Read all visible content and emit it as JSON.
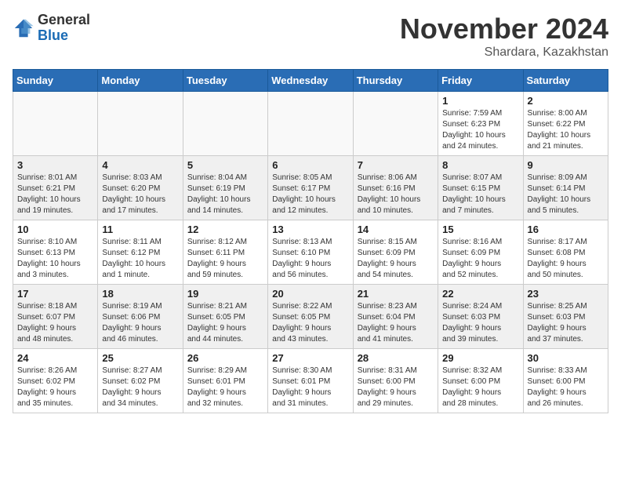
{
  "logo": {
    "general": "General",
    "blue": "Blue"
  },
  "header": {
    "month": "November 2024",
    "location": "Shardara, Kazakhstan"
  },
  "weekdays": [
    "Sunday",
    "Monday",
    "Tuesday",
    "Wednesday",
    "Thursday",
    "Friday",
    "Saturday"
  ],
  "weeks": [
    [
      {
        "day": "",
        "info": ""
      },
      {
        "day": "",
        "info": ""
      },
      {
        "day": "",
        "info": ""
      },
      {
        "day": "",
        "info": ""
      },
      {
        "day": "",
        "info": ""
      },
      {
        "day": "1",
        "info": "Sunrise: 7:59 AM\nSunset: 6:23 PM\nDaylight: 10 hours\nand 24 minutes."
      },
      {
        "day": "2",
        "info": "Sunrise: 8:00 AM\nSunset: 6:22 PM\nDaylight: 10 hours\nand 21 minutes."
      }
    ],
    [
      {
        "day": "3",
        "info": "Sunrise: 8:01 AM\nSunset: 6:21 PM\nDaylight: 10 hours\nand 19 minutes."
      },
      {
        "day": "4",
        "info": "Sunrise: 8:03 AM\nSunset: 6:20 PM\nDaylight: 10 hours\nand 17 minutes."
      },
      {
        "day": "5",
        "info": "Sunrise: 8:04 AM\nSunset: 6:19 PM\nDaylight: 10 hours\nand 14 minutes."
      },
      {
        "day": "6",
        "info": "Sunrise: 8:05 AM\nSunset: 6:17 PM\nDaylight: 10 hours\nand 12 minutes."
      },
      {
        "day": "7",
        "info": "Sunrise: 8:06 AM\nSunset: 6:16 PM\nDaylight: 10 hours\nand 10 minutes."
      },
      {
        "day": "8",
        "info": "Sunrise: 8:07 AM\nSunset: 6:15 PM\nDaylight: 10 hours\nand 7 minutes."
      },
      {
        "day": "9",
        "info": "Sunrise: 8:09 AM\nSunset: 6:14 PM\nDaylight: 10 hours\nand 5 minutes."
      }
    ],
    [
      {
        "day": "10",
        "info": "Sunrise: 8:10 AM\nSunset: 6:13 PM\nDaylight: 10 hours\nand 3 minutes."
      },
      {
        "day": "11",
        "info": "Sunrise: 8:11 AM\nSunset: 6:12 PM\nDaylight: 10 hours\nand 1 minute."
      },
      {
        "day": "12",
        "info": "Sunrise: 8:12 AM\nSunset: 6:11 PM\nDaylight: 9 hours\nand 59 minutes."
      },
      {
        "day": "13",
        "info": "Sunrise: 8:13 AM\nSunset: 6:10 PM\nDaylight: 9 hours\nand 56 minutes."
      },
      {
        "day": "14",
        "info": "Sunrise: 8:15 AM\nSunset: 6:09 PM\nDaylight: 9 hours\nand 54 minutes."
      },
      {
        "day": "15",
        "info": "Sunrise: 8:16 AM\nSunset: 6:09 PM\nDaylight: 9 hours\nand 52 minutes."
      },
      {
        "day": "16",
        "info": "Sunrise: 8:17 AM\nSunset: 6:08 PM\nDaylight: 9 hours\nand 50 minutes."
      }
    ],
    [
      {
        "day": "17",
        "info": "Sunrise: 8:18 AM\nSunset: 6:07 PM\nDaylight: 9 hours\nand 48 minutes."
      },
      {
        "day": "18",
        "info": "Sunrise: 8:19 AM\nSunset: 6:06 PM\nDaylight: 9 hours\nand 46 minutes."
      },
      {
        "day": "19",
        "info": "Sunrise: 8:21 AM\nSunset: 6:05 PM\nDaylight: 9 hours\nand 44 minutes."
      },
      {
        "day": "20",
        "info": "Sunrise: 8:22 AM\nSunset: 6:05 PM\nDaylight: 9 hours\nand 43 minutes."
      },
      {
        "day": "21",
        "info": "Sunrise: 8:23 AM\nSunset: 6:04 PM\nDaylight: 9 hours\nand 41 minutes."
      },
      {
        "day": "22",
        "info": "Sunrise: 8:24 AM\nSunset: 6:03 PM\nDaylight: 9 hours\nand 39 minutes."
      },
      {
        "day": "23",
        "info": "Sunrise: 8:25 AM\nSunset: 6:03 PM\nDaylight: 9 hours\nand 37 minutes."
      }
    ],
    [
      {
        "day": "24",
        "info": "Sunrise: 8:26 AM\nSunset: 6:02 PM\nDaylight: 9 hours\nand 35 minutes."
      },
      {
        "day": "25",
        "info": "Sunrise: 8:27 AM\nSunset: 6:02 PM\nDaylight: 9 hours\nand 34 minutes."
      },
      {
        "day": "26",
        "info": "Sunrise: 8:29 AM\nSunset: 6:01 PM\nDaylight: 9 hours\nand 32 minutes."
      },
      {
        "day": "27",
        "info": "Sunrise: 8:30 AM\nSunset: 6:01 PM\nDaylight: 9 hours\nand 31 minutes."
      },
      {
        "day": "28",
        "info": "Sunrise: 8:31 AM\nSunset: 6:00 PM\nDaylight: 9 hours\nand 29 minutes."
      },
      {
        "day": "29",
        "info": "Sunrise: 8:32 AM\nSunset: 6:00 PM\nDaylight: 9 hours\nand 28 minutes."
      },
      {
        "day": "30",
        "info": "Sunrise: 8:33 AM\nSunset: 6:00 PM\nDaylight: 9 hours\nand 26 minutes."
      }
    ]
  ]
}
